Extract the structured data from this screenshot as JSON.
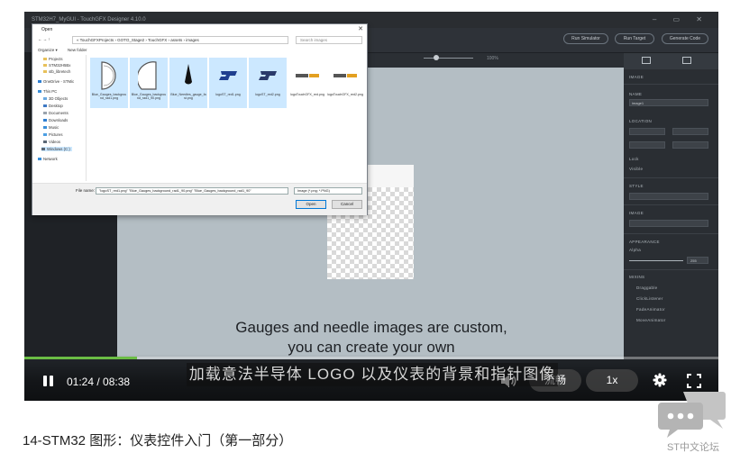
{
  "video": {
    "window_title": "STM32H7_MyGUI - TouchGFX Designer 4.10.0",
    "toolbar_buttons": [
      "Run Simulator",
      "Run Target",
      "Generate Code"
    ],
    "zoom": "100%",
    "caption_en_line1": "Gauges and needle images are custom,",
    "caption_en_line2": "you can create your own",
    "subtitle_cn": "加载意法半导体 LOGO 以及仪表的背景和指针图像",
    "right_panel": {
      "section_image": "IMAGE",
      "label_name": "NAME",
      "name_value": "image1",
      "label_location": "LOCATION",
      "lock": "Lock",
      "visible": "Visible",
      "label_style": "STYLE",
      "label_image": "IMAGE",
      "label_appearance": "APPEARANCE",
      "alpha": "Alpha",
      "alpha_value": "255",
      "label_mixins": "MIXINS",
      "mixins": [
        "Draggable",
        "ClickListener",
        "FadeAnimator",
        "MoveAnimator"
      ]
    },
    "dialog": {
      "title": "Open",
      "path": "« TouchGFXProjects › GOTO_Stage2 › TouchGFX › assets › images",
      "search_placeholder": "Search images",
      "organize": "Organize ▾",
      "new_folder": "New folder",
      "tree": [
        "Projects",
        "STM32H5Bx",
        "stb_libretech",
        "OneDrive - STMic",
        "This PC",
        "3D Objects",
        "Desktop",
        "Documents",
        "Downloads",
        "Music",
        "Pictures",
        "Videos",
        "Windows (C:)",
        "Network"
      ],
      "files": [
        {
          "name": "Blue_Gauges_background_rad1.png",
          "selected": true
        },
        {
          "name": "Blue_Gauges_background_rad1_90.png",
          "selected": true
        },
        {
          "name": "Blue_Needles_gauge_fast.png",
          "selected": true
        },
        {
          "name": "logoST_red1.png",
          "selected": true
        },
        {
          "name": "logoST_red2.png",
          "selected": true
        },
        {
          "name": "logoTouchGFX_red.png",
          "selected": false
        },
        {
          "name": "logoTouchGFX_red2.png",
          "selected": false
        }
      ],
      "file_name_label": "File name:",
      "file_name_value": "\"logoST_red1.png\" \"Blue_Gauges_background_rad1_90.png\" \"Blue_Gauges_background_rad1_90\"",
      "file_type": "Image (*.png; *.PNG)",
      "open_label": "Open",
      "cancel_label": "Cancel"
    },
    "controls": {
      "time": "01:24 / 08:38",
      "quality": "流畅",
      "speed": "1x",
      "progress": 0.162
    }
  },
  "page": {
    "title": "14-STM32 图形：仪表控件入门（第一部分）",
    "logo_text": "ST中文论坛"
  },
  "colors": {
    "progress": "#6bbd45",
    "canvas": "#b4bec4",
    "selection": "#cce8ff"
  }
}
